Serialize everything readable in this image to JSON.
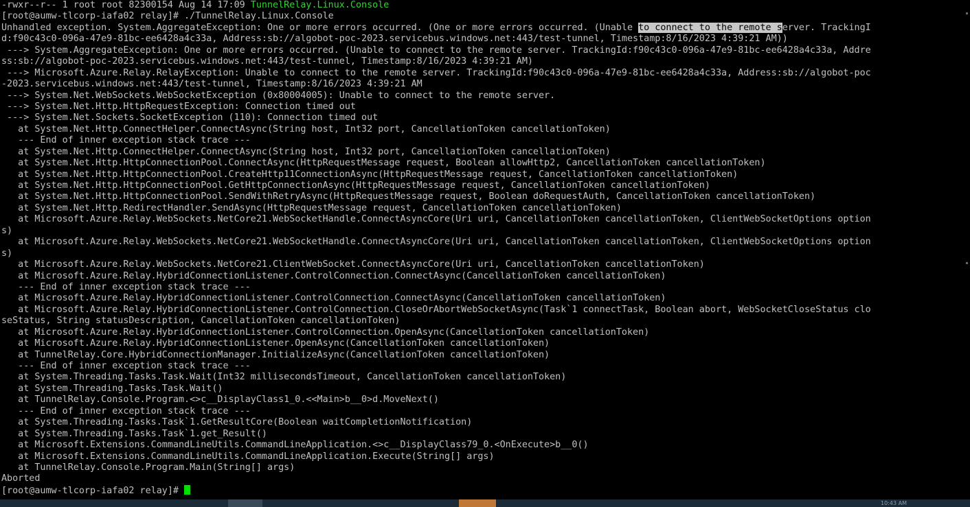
{
  "terminal": {
    "ls_line": {
      "perms": "-rwxr--r-- 1 root root 82300154 Aug 14 17:09 ",
      "filename": "TunnelRelay.Linux.Console"
    },
    "command_line": "[root@aumw-tlcorp-iafa02 relay]# ./TunnelRelay.Linux.Console",
    "line_exc_before": "Unhandled exception. System.AggregateException: One or more errors occurred. (One or more errors occurred. (Unable ",
    "line_exc_selected": "to connect to the remote s",
    "line_exc_after": "erver. TrackingI",
    "lines": [
      "d:f90c43c0-096a-47e9-81bc-ee6428a4c33a, Address:sb://algobot-poc-2023.servicebus.windows.net:443/test-tunnel, Timestamp:8/16/2023 4:39:21 AM))",
      " ---> System.AggregateException: One or more errors occurred. (Unable to connect to the remote server. TrackingId:f90c43c0-096a-47e9-81bc-ee6428a4c33a, Addre",
      "ss:sb://algobot-poc-2023.servicebus.windows.net:443/test-tunnel, Timestamp:8/16/2023 4:39:21 AM)",
      " ---> Microsoft.Azure.Relay.RelayException: Unable to connect to the remote server. TrackingId:f90c43c0-096a-47e9-81bc-ee6428a4c33a, Address:sb://algobot-poc",
      "-2023.servicebus.windows.net:443/test-tunnel, Timestamp:8/16/2023 4:39:21 AM",
      " ---> System.Net.WebSockets.WebSocketException (0x80004005): Unable to connect to the remote server.",
      " ---> System.Net.Http.HttpRequestException: Connection timed out",
      " ---> System.Net.Sockets.SocketException (110): Connection timed out",
      "   at System.Net.Http.ConnectHelper.ConnectAsync(String host, Int32 port, CancellationToken cancellationToken)",
      "   --- End of inner exception stack trace ---",
      "   at System.Net.Http.ConnectHelper.ConnectAsync(String host, Int32 port, CancellationToken cancellationToken)",
      "   at System.Net.Http.HttpConnectionPool.ConnectAsync(HttpRequestMessage request, Boolean allowHttp2, CancellationToken cancellationToken)",
      "   at System.Net.Http.HttpConnectionPool.CreateHttp11ConnectionAsync(HttpRequestMessage request, CancellationToken cancellationToken)",
      "   at System.Net.Http.HttpConnectionPool.GetHttpConnectionAsync(HttpRequestMessage request, CancellationToken cancellationToken)",
      "   at System.Net.Http.HttpConnectionPool.SendWithRetryAsync(HttpRequestMessage request, Boolean doRequestAuth, CancellationToken cancellationToken)",
      "   at System.Net.Http.RedirectHandler.SendAsync(HttpRequestMessage request, CancellationToken cancellationToken)",
      "   at Microsoft.Azure.Relay.WebSockets.NetCore21.WebSocketHandle.ConnectAsyncCore(Uri uri, CancellationToken cancellationToken, ClientWebSocketOptions option",
      "s)",
      "   at Microsoft.Azure.Relay.WebSockets.NetCore21.WebSocketHandle.ConnectAsyncCore(Uri uri, CancellationToken cancellationToken, ClientWebSocketOptions option",
      "s)",
      "   at Microsoft.Azure.Relay.WebSockets.NetCore21.ClientWebSocket.ConnectAsyncCore(Uri uri, CancellationToken cancellationToken)",
      "   at Microsoft.Azure.Relay.HybridConnectionListener.ControlConnection.ConnectAsync(CancellationToken cancellationToken)",
      "   --- End of inner exception stack trace ---",
      "   at Microsoft.Azure.Relay.HybridConnectionListener.ControlConnection.ConnectAsync(CancellationToken cancellationToken)",
      "   at Microsoft.Azure.Relay.HybridConnectionListener.ControlConnection.CloseOrAbortWebSocketAsync(Task`1 connectTask, Boolean abort, WebSocketCloseStatus clo",
      "seStatus, String statusDescription, CancellationToken cancellationToken)",
      "   at Microsoft.Azure.Relay.HybridConnectionListener.ControlConnection.OpenAsync(CancellationToken cancellationToken)",
      "   at Microsoft.Azure.Relay.HybridConnectionListener.OpenAsync(CancellationToken cancellationToken)",
      "   at TunnelRelay.Core.HybridConnectionManager.InitializeAsync(CancellationToken cancellationToken)",
      "   --- End of inner exception stack trace ---",
      "   at System.Threading.Tasks.Task.Wait(Int32 millisecondsTimeout, CancellationToken cancellationToken)",
      "   at System.Threading.Tasks.Task.Wait()",
      "   at TunnelRelay.Console.Program.<>c__DisplayClass1_0.<<Main>b__0>d.MoveNext()",
      "   --- End of inner exception stack trace ---",
      "   at System.Threading.Tasks.Task`1.GetResultCore(Boolean waitCompletionNotification)",
      "   at System.Threading.Tasks.Task`1.get_Result()",
      "   at Microsoft.Extensions.CommandLineUtils.CommandLineApplication.<>c__DisplayClass79_0.<OnExecute>b__0()",
      "   at Microsoft.Extensions.CommandLineUtils.CommandLineApplication.Execute(String[] args)",
      "   at TunnelRelay.Console.Program.Main(String[] args)",
      "Aborted"
    ],
    "prompt": "[root@aumw-tlcorp-iafa02 relay]# "
  },
  "taskbar": {
    "clock_partial": "10:43 AM"
  },
  "colors": {
    "background": "#000000",
    "text": "#c0c0c0",
    "filename_green": "#33d333",
    "cursor": "#00e000",
    "selection_bg": "#c8c8c8"
  }
}
